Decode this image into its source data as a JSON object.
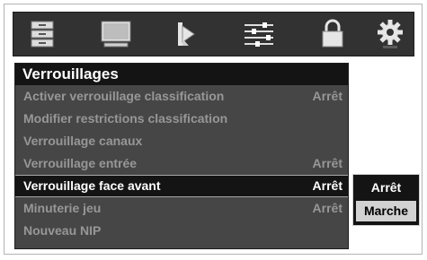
{
  "top_icons": [
    {
      "name": "picture-settings-icon"
    },
    {
      "name": "tv-screen-icon"
    },
    {
      "name": "speaker-icon"
    },
    {
      "name": "equalizer-sliders-icon"
    },
    {
      "name": "lock-icon"
    },
    {
      "name": "gear-icon"
    }
  ],
  "menu": {
    "title": "Verrouillages",
    "items": [
      {
        "label": "Activer verrouillage classification",
        "value": "Arrêt"
      },
      {
        "label": "Modifier restrictions classification",
        "value": ""
      },
      {
        "label": "Verrouillage canaux",
        "value": ""
      },
      {
        "label": "Verrouillage entrée",
        "value": "Arrêt"
      },
      {
        "label": "Verrouillage face avant",
        "value": "Arrêt"
      },
      {
        "label": "Minuterie jeu",
        "value": "Arrêt"
      },
      {
        "label": "Nouveau NIP",
        "value": ""
      }
    ]
  },
  "popup": {
    "options": [
      "Arrêt",
      "Marche"
    ],
    "highlighted": "Marche"
  },
  "colors": {
    "menu_bg": "#464646",
    "selected_bg": "#141414",
    "inactive_text": "#979797",
    "highlight_option": "#d2d2d2"
  }
}
